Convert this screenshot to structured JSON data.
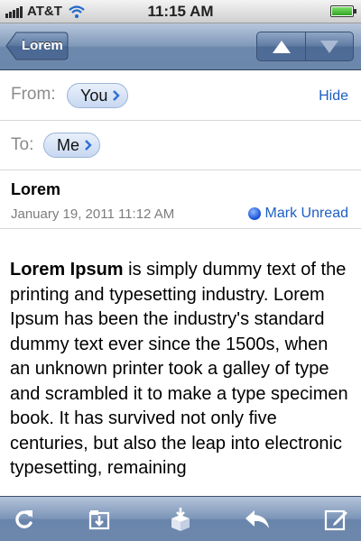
{
  "status_bar": {
    "carrier": "AT&T",
    "time": "11:15 AM",
    "signal_icon": "signal-bars-icon",
    "wifi_icon": "wifi-icon",
    "battery_icon": "battery-icon",
    "battery_level": 1.0
  },
  "nav_bar": {
    "back_label": "Lorem",
    "prev_icon": "triangle-up-icon",
    "next_icon": "triangle-down-icon"
  },
  "header": {
    "from_label": "From:",
    "from_value": "You",
    "hide_label": "Hide",
    "to_label": "To:",
    "to_value": "Me",
    "subject": "Lorem",
    "date": "January 19, 2011 11:12 AM",
    "mark_unread_label": "Mark Unread"
  },
  "message": {
    "bold_lead": "Lorem Ipsum",
    "text": " is simply dummy text of the printing and typesetting industry. Lorem Ipsum has been the industry's standard dummy text ever since the 1500s, when an unknown printer took a galley of type and scrambled it to make a type specimen book. It has survived not only five centuries, but also the leap into electronic typesetting, remaining"
  },
  "toolbar": {
    "icons": [
      "refresh-icon",
      "move-to-folder-icon",
      "archive-icon",
      "reply-icon",
      "compose-icon"
    ]
  },
  "colors": {
    "link_blue": "#1c5fc4",
    "nav_blue": "#6d88ad",
    "pill_bg": "#c8d8f1"
  }
}
